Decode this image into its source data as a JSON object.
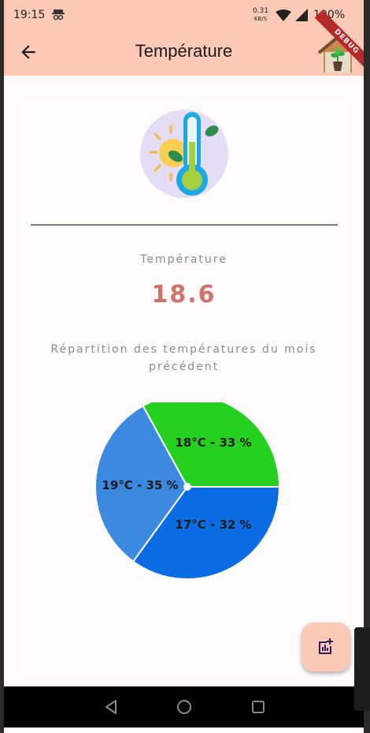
{
  "status_bar": {
    "time": "19:15",
    "speed_value": "0.31",
    "speed_unit": "KB/S",
    "battery": "100%"
  },
  "app_bar": {
    "title": "Température",
    "debug_banner": "DEBUG"
  },
  "reading": {
    "label": "Température",
    "value": "18.6"
  },
  "chart_caption": "Répartition des températures du mois précédent",
  "chart_data": {
    "type": "pie",
    "slices": [
      {
        "label": "18°C - 33 %",
        "value": 33,
        "color": "#26d01f"
      },
      {
        "label": "17°C - 32 %",
        "value": 32,
        "color": "#3b8ae0"
      },
      {
        "label": "19°C - 35 %",
        "value": 35,
        "color": "#0c6ce4"
      }
    ]
  },
  "colors": {
    "app_bar": "#fcc9b6",
    "value": "#d3726b"
  },
  "icons": {
    "back": "arrow-left-icon",
    "home": "house-plant-icon",
    "fab": "add-chart-icon"
  }
}
